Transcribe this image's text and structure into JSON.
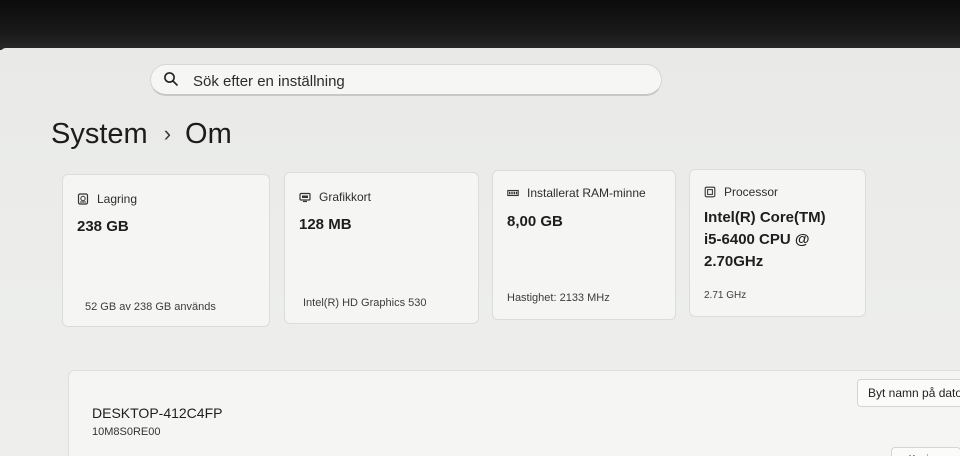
{
  "search": {
    "placeholder": "Sök efter en inställning"
  },
  "breadcrumb": {
    "parent": "System",
    "separator": "›",
    "current": "Om"
  },
  "cards": [
    {
      "icon": "storage-icon",
      "title": "Lagring",
      "value": "238 GB",
      "detail": "52 GB av 238 GB används"
    },
    {
      "icon": "graphics-card-icon",
      "title": "Grafikkort",
      "value": "128 MB",
      "detail": "Intel(R) HD Graphics 530"
    },
    {
      "icon": "ram-icon",
      "title": "Installerat RAM-minne",
      "value": "8,00 GB",
      "detail": "Hastighet: 2133 MHz"
    },
    {
      "icon": "processor-icon",
      "title": "Processor",
      "value": "Intel(R) Core(TM) i5-6400 CPU @ 2.70GHz",
      "detail": "2.71 GHz"
    }
  ],
  "device": {
    "name": "DESKTOP-412C4FP",
    "model": "10M8S0RE00",
    "rename_label": "Byt namn på dator",
    "copy_label": "Kopiera"
  },
  "colors": {
    "bezel": "#141414",
    "background": "#eceeeb",
    "card": "#f5f5f4"
  }
}
